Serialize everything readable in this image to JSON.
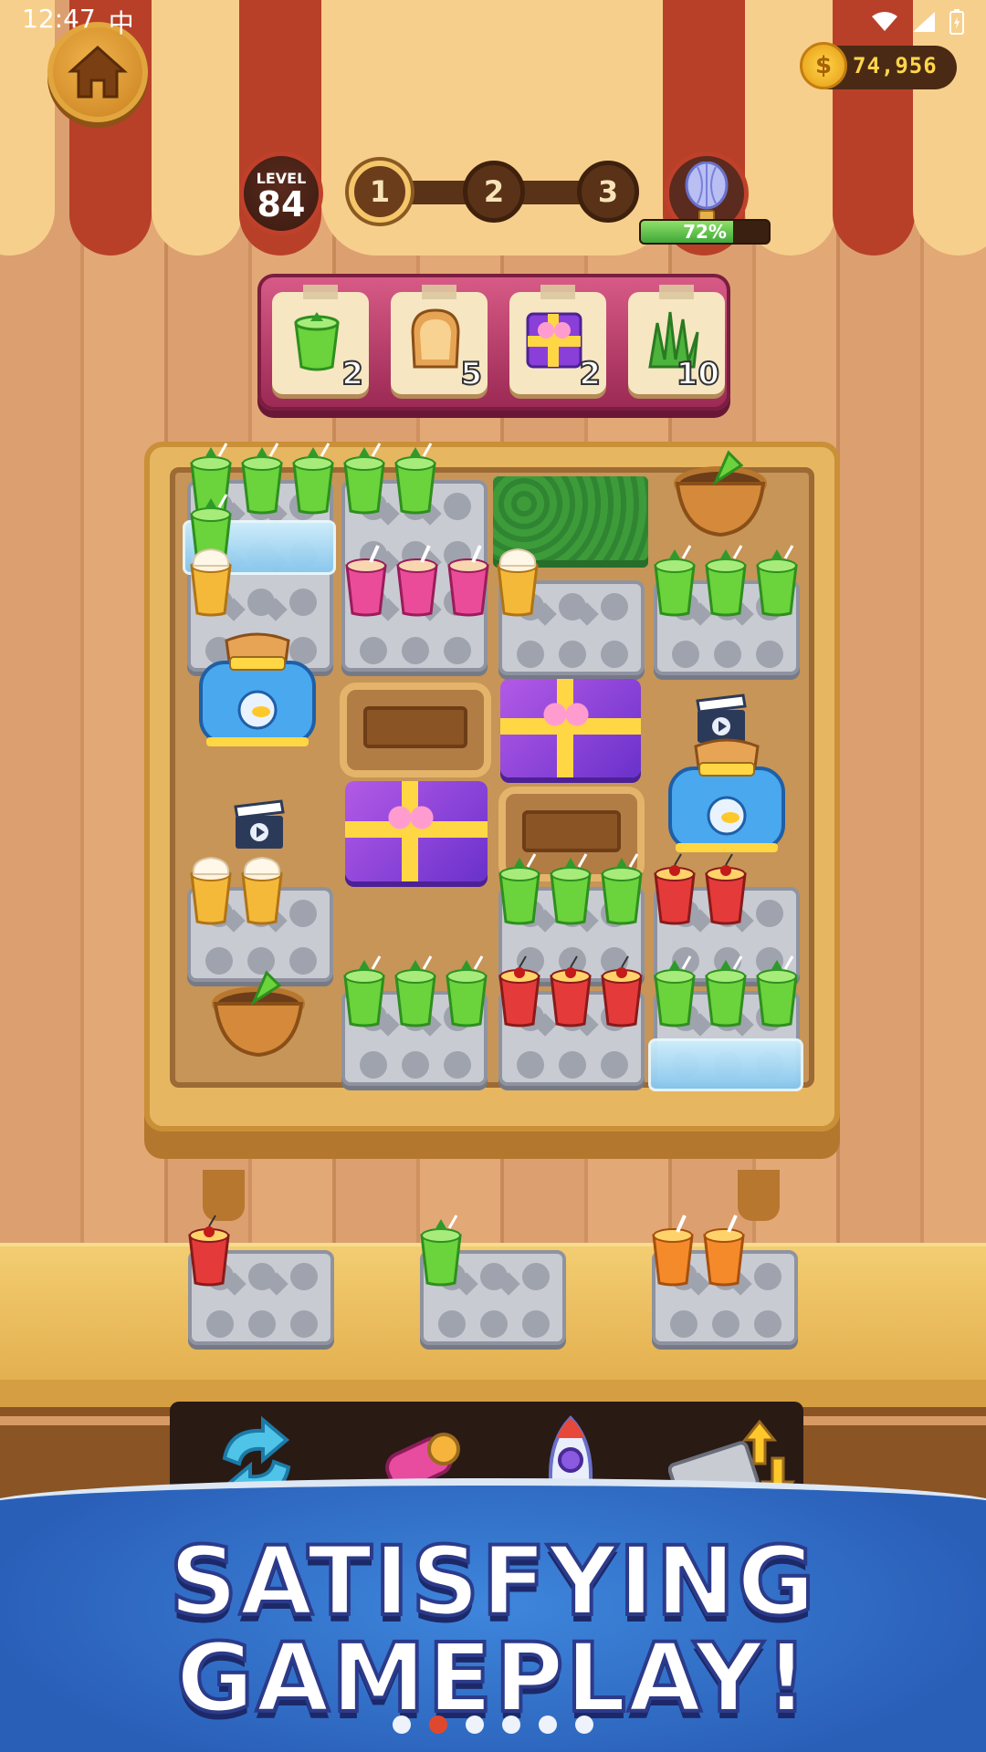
{
  "status_bar": {
    "time": "12:47",
    "carrier_glyph": "中"
  },
  "header": {
    "coins": "74,956",
    "level_label": "LEVEL",
    "level_number": "84",
    "stages": [
      "1",
      "2",
      "3"
    ],
    "current_stage": "1",
    "reward_progress_text": "72%",
    "reward_progress": 0.72
  },
  "goals": [
    {
      "item": "lime-mojito-icon",
      "count": "2"
    },
    {
      "item": "toast-bread-icon",
      "count": "5"
    },
    {
      "item": "gift-box-icon",
      "count": "2"
    },
    {
      "item": "grass-icon",
      "count": "10"
    }
  ],
  "boosters": [
    "shuffle-icon",
    "magnet-icon",
    "rocket-icon",
    "tray-swap-icon"
  ],
  "banner": {
    "line1": "SATISFYING",
    "line2": "GAMEPLAY!"
  },
  "pagination": {
    "total": 6,
    "active_index": 1
  },
  "colors": {
    "accent_red": "#b84028",
    "banner_blue": "#2a5fb8",
    "mojito_green": "#6bd33b",
    "gift_purple": "#8a3fd8"
  }
}
